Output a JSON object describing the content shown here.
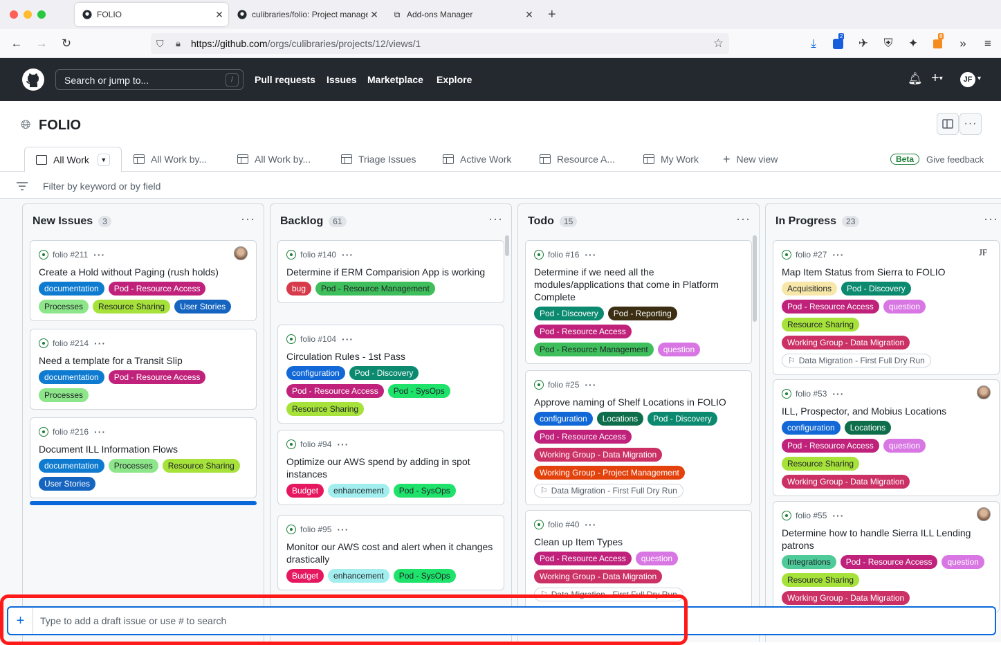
{
  "browser": {
    "tabs": [
      {
        "title": "FOLIO",
        "active": true
      },
      {
        "title": "culibraries/folio: Project manage",
        "active": false
      },
      {
        "title": "Add-ons Manager",
        "active": false
      }
    ],
    "url_host": "https://github.com",
    "url_path": "/orgs/culibraries/projects/12/views/1",
    "badge_count": "2",
    "addon_badge": "8"
  },
  "github": {
    "search_placeholder": "Search or jump to...",
    "search_key": "/",
    "nav": [
      "Pull requests",
      "Issues",
      "Marketplace",
      "Explore"
    ],
    "user_initials": "JF"
  },
  "project": {
    "title": "FOLIO",
    "views": [
      "All Work",
      "All Work by...",
      "All Work by...",
      "Triage Issues",
      "Active Work",
      "Resource A...",
      "My Work"
    ],
    "new_view": "New view",
    "beta": "Beta",
    "feedback": "Give feedback",
    "filter_placeholder": "Filter by keyword or by field"
  },
  "colors": {
    "documentation": "#0e7bd0",
    "pod_resource_access": "#c0227b",
    "processes": "#8ee68a",
    "resource_sharing": "#a6e23a",
    "user_stories": "#1565c0",
    "bug": "#d73a4a",
    "pod_resource_management": "#3fbf5c",
    "configuration": "#1168d6",
    "pod_discovery": "#0b8a6f",
    "pod_sysops": "#1ee26a",
    "budget": "#e5185f",
    "enhancement": "#a2eeef",
    "pod_reporting": "#3b2e12",
    "question": "#d876e3",
    "locations": "#0e6e4c",
    "working_group_data_migration": "#cc3166",
    "working_group_project_management": "#e4420c",
    "acquisitions": "#f7e7a8",
    "integrations": "#4fcb9a"
  },
  "columns": [
    {
      "name": "New Issues",
      "count": "3",
      "cards": [
        {
          "ref": "folio #211",
          "title": "Create a Hold without Paging (rush holds)",
          "labels": [
            "documentation",
            "Pod - Resource Access",
            "Processes",
            "Resource Sharing",
            "User Stories"
          ]
        },
        {
          "ref": "folio #214",
          "title": "Need a template for a Transit Slip",
          "labels": [
            "documentation",
            "Pod - Resource Access",
            "Processes"
          ]
        },
        {
          "ref": "folio #216",
          "title": "Document ILL Information Flows",
          "labels": [
            "documentation",
            "Processes",
            "Resource Sharing",
            "User Stories"
          ]
        }
      ]
    },
    {
      "name": "Backlog",
      "count": "61",
      "cards": [
        {
          "ref": "folio #140",
          "title": "Determine if ERM Comparision App is working",
          "labels": [
            "bug",
            "Pod - Resource Management"
          ]
        },
        {
          "ref": "folio #104",
          "title": "Circulation Rules - 1st Pass",
          "labels": [
            "configuration",
            "Pod - Discovery",
            "Pod - Resource Access",
            "Pod - SysOps",
            "Resource Sharing"
          ]
        },
        {
          "ref": "folio #94",
          "title": "Optimize our AWS spend by adding in spot instances",
          "labels": [
            "Budget",
            "enhancement",
            "Pod - SysOps"
          ]
        },
        {
          "ref": "folio #95",
          "title": "Monitor our AWS cost and alert when it changes drastically",
          "labels": [
            "Budget",
            "enhancement",
            "Pod - SysOps"
          ]
        }
      ]
    },
    {
      "name": "Todo",
      "count": "15",
      "cards": [
        {
          "ref": "folio #16",
          "title": "Determine if we need all the modules/applications that come in Platform Complete",
          "labels": [
            "Pod - Discovery",
            "Pod - Reporting",
            "Pod - Resource Access",
            "Pod - Resource Management",
            "question"
          ]
        },
        {
          "ref": "folio #25",
          "title": "Approve naming of Shelf Locations in FOLIO",
          "labels": [
            "configuration",
            "Locations",
            "Pod - Discovery",
            "Pod - Resource Access",
            "Working Group - Data Migration",
            "Working Group - Project Management"
          ],
          "milestone": "Data Migration - First Full Dry Run"
        },
        {
          "ref": "folio #40",
          "title": "Clean up Item Types",
          "labels": [
            "Pod - Resource Access",
            "question",
            "Working Group - Data Migration"
          ],
          "milestone": "Data Migration - First Full Dry Run"
        }
      ]
    },
    {
      "name": "In Progress",
      "count": "23",
      "cards": [
        {
          "ref": "folio #27",
          "title": "Map Item Status from Sierra to FOLIO",
          "labels": [
            "Acquisitions",
            "Pod - Discovery",
            "Pod - Resource Access",
            "question",
            "Resource Sharing",
            "Working Group - Data Migration"
          ],
          "milestone": "Data Migration - First Full Dry Run",
          "avatar": "JF"
        },
        {
          "ref": "folio #53",
          "title": "ILL, Prospector, and Mobius Locations",
          "labels": [
            "configuration",
            "Locations",
            "Pod - Resource Access",
            "question",
            "Resource Sharing",
            "Working Group - Data Migration"
          ]
        },
        {
          "ref": "folio #55",
          "title": "Determine how to handle Sierra ILL Lending patrons",
          "labels": [
            "Integrations",
            "Pod - Resource Access",
            "question",
            "Resource Sharing",
            "Working Group - Data Migration"
          ]
        }
      ]
    }
  ],
  "draft": {
    "plus": "+",
    "placeholder": "Type to add a draft issue or use # to search"
  }
}
